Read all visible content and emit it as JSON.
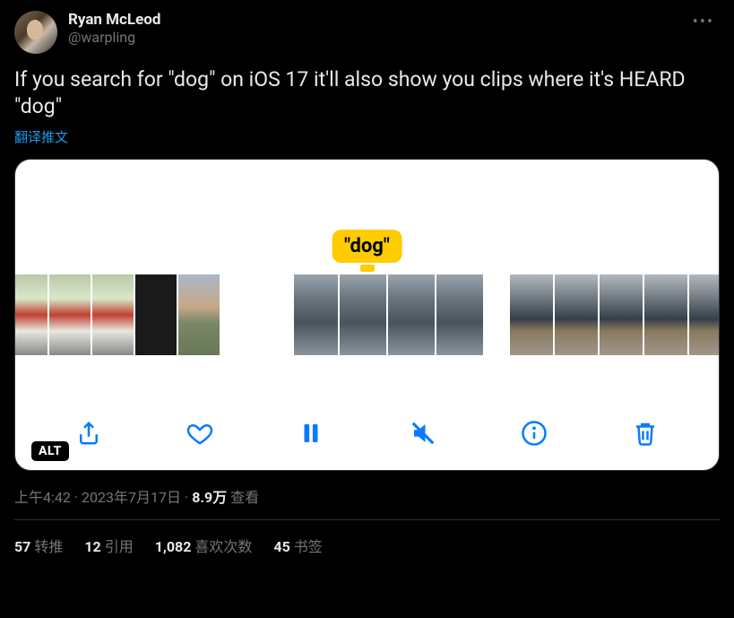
{
  "author": {
    "display_name": "Ryan McLeod",
    "handle": "@warpling"
  },
  "body_text": "If you search for \"dog\" on iOS 17 it'll also show you clips where it's HEARD \"dog\"",
  "translate_label": "翻译推文",
  "media": {
    "tooltip_label": "\"dog\"",
    "alt_badge": "ALT",
    "controls": {
      "share": "share-icon",
      "like": "heart-icon",
      "pause": "pause-icon",
      "mute": "mute-icon",
      "info": "info-icon",
      "trash": "trash-icon"
    }
  },
  "meta": {
    "time": "上午4:42",
    "date": "2023年7月17日",
    "views_count": "8.9万",
    "views_label": "查看"
  },
  "stats": {
    "retweets": {
      "count": "57",
      "label": "转推"
    },
    "quotes": {
      "count": "12",
      "label": "引用"
    },
    "likes": {
      "count": "1,082",
      "label": "喜欢次数"
    },
    "bookmarks": {
      "count": "45",
      "label": "书签"
    }
  }
}
